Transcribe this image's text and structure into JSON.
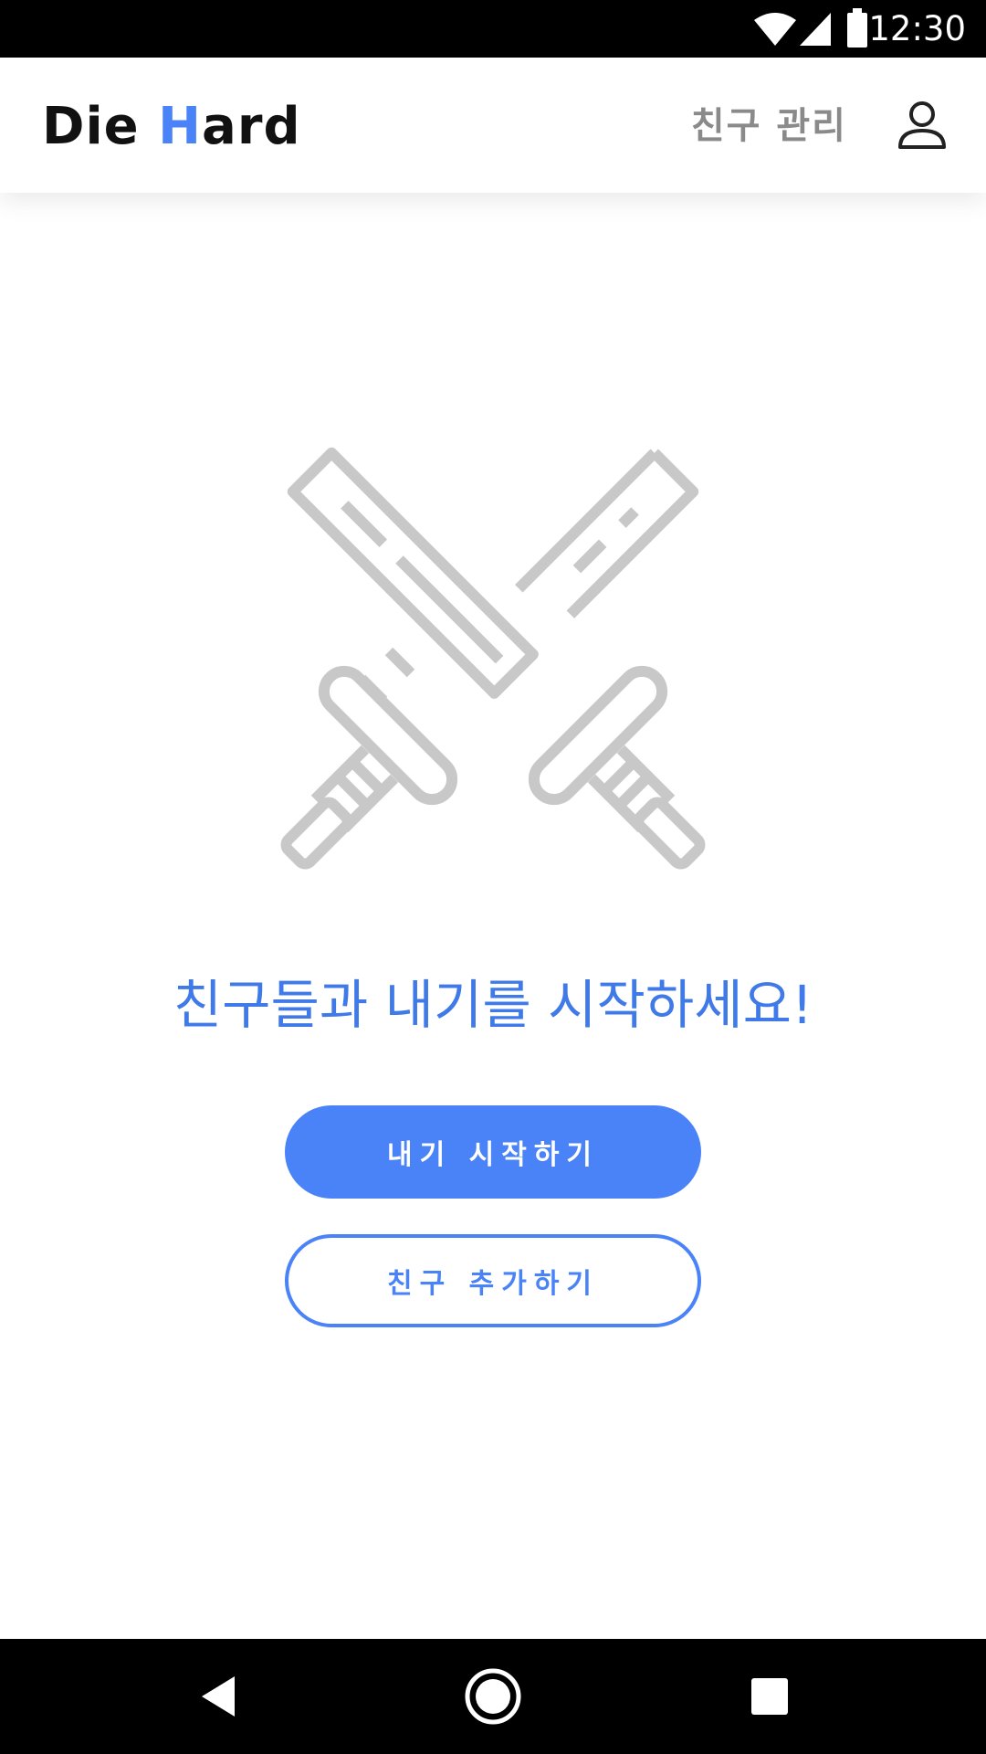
{
  "status_bar": {
    "time": "12:30",
    "icons": [
      "wifi-icon",
      "cell-signal-icon",
      "battery-icon"
    ]
  },
  "app_bar": {
    "logo_part1": "Die ",
    "logo_accent": "H",
    "logo_part2": "ard",
    "friends_link": "친구 관리",
    "profile_icon": "user-icon"
  },
  "main": {
    "illustration_icon": "crossed-swords-icon",
    "headline": "친구들과 내기를 시작하세요!",
    "start_bet_button": "내기 시작하기",
    "add_friend_button": "친구 추가하기"
  },
  "nav_bar": {
    "icons": [
      "back-icon",
      "home-icon",
      "recents-icon"
    ]
  },
  "colors": {
    "accent": "#4a82f7",
    "headline": "#3f7ae8",
    "illustration": "#c8c8c8",
    "muted_text": "#8a8a8a"
  }
}
